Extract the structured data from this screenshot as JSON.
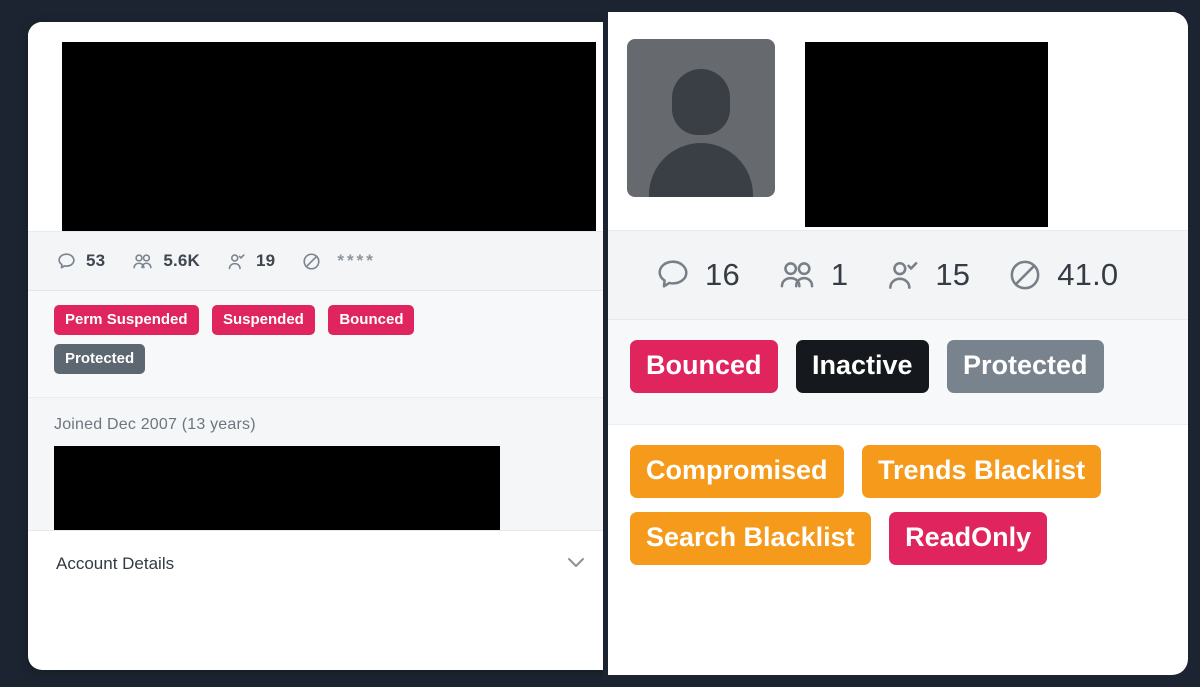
{
  "theme": {
    "background": "#1b2430",
    "card_background": "#ffffff",
    "band_background": "#f2f4f6",
    "crimson": "#e0245e",
    "slate": "#5d6772",
    "slate_light": "#78838e",
    "dark": "#15181c",
    "orange": "#f59a1a",
    "text_primary": "#323a43",
    "text_muted": "#6d767f"
  },
  "left_panel": {
    "banner": {
      "redacted": true
    },
    "stats": [
      {
        "icon": "speech-bubble-icon",
        "label": "tweets",
        "value": "53"
      },
      {
        "icon": "people-group-icon",
        "label": "followers",
        "value": "5.6K"
      },
      {
        "icon": "person-check-icon",
        "label": "following",
        "value": "19"
      },
      {
        "icon": "circle-slash-icon",
        "label": "blocked",
        "value": "****"
      }
    ],
    "badges": [
      {
        "label": "Perm Suspended",
        "color": "crimson"
      },
      {
        "label": "Suspended",
        "color": "crimson"
      },
      {
        "label": "Bounced",
        "color": "crimson"
      },
      {
        "label": "Protected",
        "color": "slate"
      }
    ],
    "joined": "Joined Dec 2007 (13 years)",
    "joined_detail": {
      "redacted": true
    },
    "footer": {
      "label": "Account Details",
      "expand_icon": "chevron-down-icon"
    }
  },
  "right_panel": {
    "avatar": {
      "icon": "person-placeholder-avatar",
      "redacted": false
    },
    "name": {
      "redacted": true
    },
    "stats": [
      {
        "icon": "speech-bubble-icon",
        "label": "tweets",
        "value": "16"
      },
      {
        "icon": "people-group-icon",
        "label": "followers",
        "value": "1"
      },
      {
        "icon": "person-check-icon",
        "label": "following",
        "value": "15"
      },
      {
        "icon": "circle-slash-icon",
        "label": "blocked",
        "value": "41.0"
      }
    ],
    "badges_primary": [
      {
        "label": "Bounced",
        "color": "crimson"
      },
      {
        "label": "Inactive",
        "color": "dark"
      },
      {
        "label": "Protected",
        "color": "slate_light"
      }
    ],
    "badges_secondary": [
      {
        "label": "Compromised",
        "color": "orange"
      },
      {
        "label": "Trends Blacklist",
        "color": "orange"
      },
      {
        "label": "Search Blacklist",
        "color": "orange"
      },
      {
        "label": "ReadOnly",
        "color": "crimson"
      }
    ]
  }
}
